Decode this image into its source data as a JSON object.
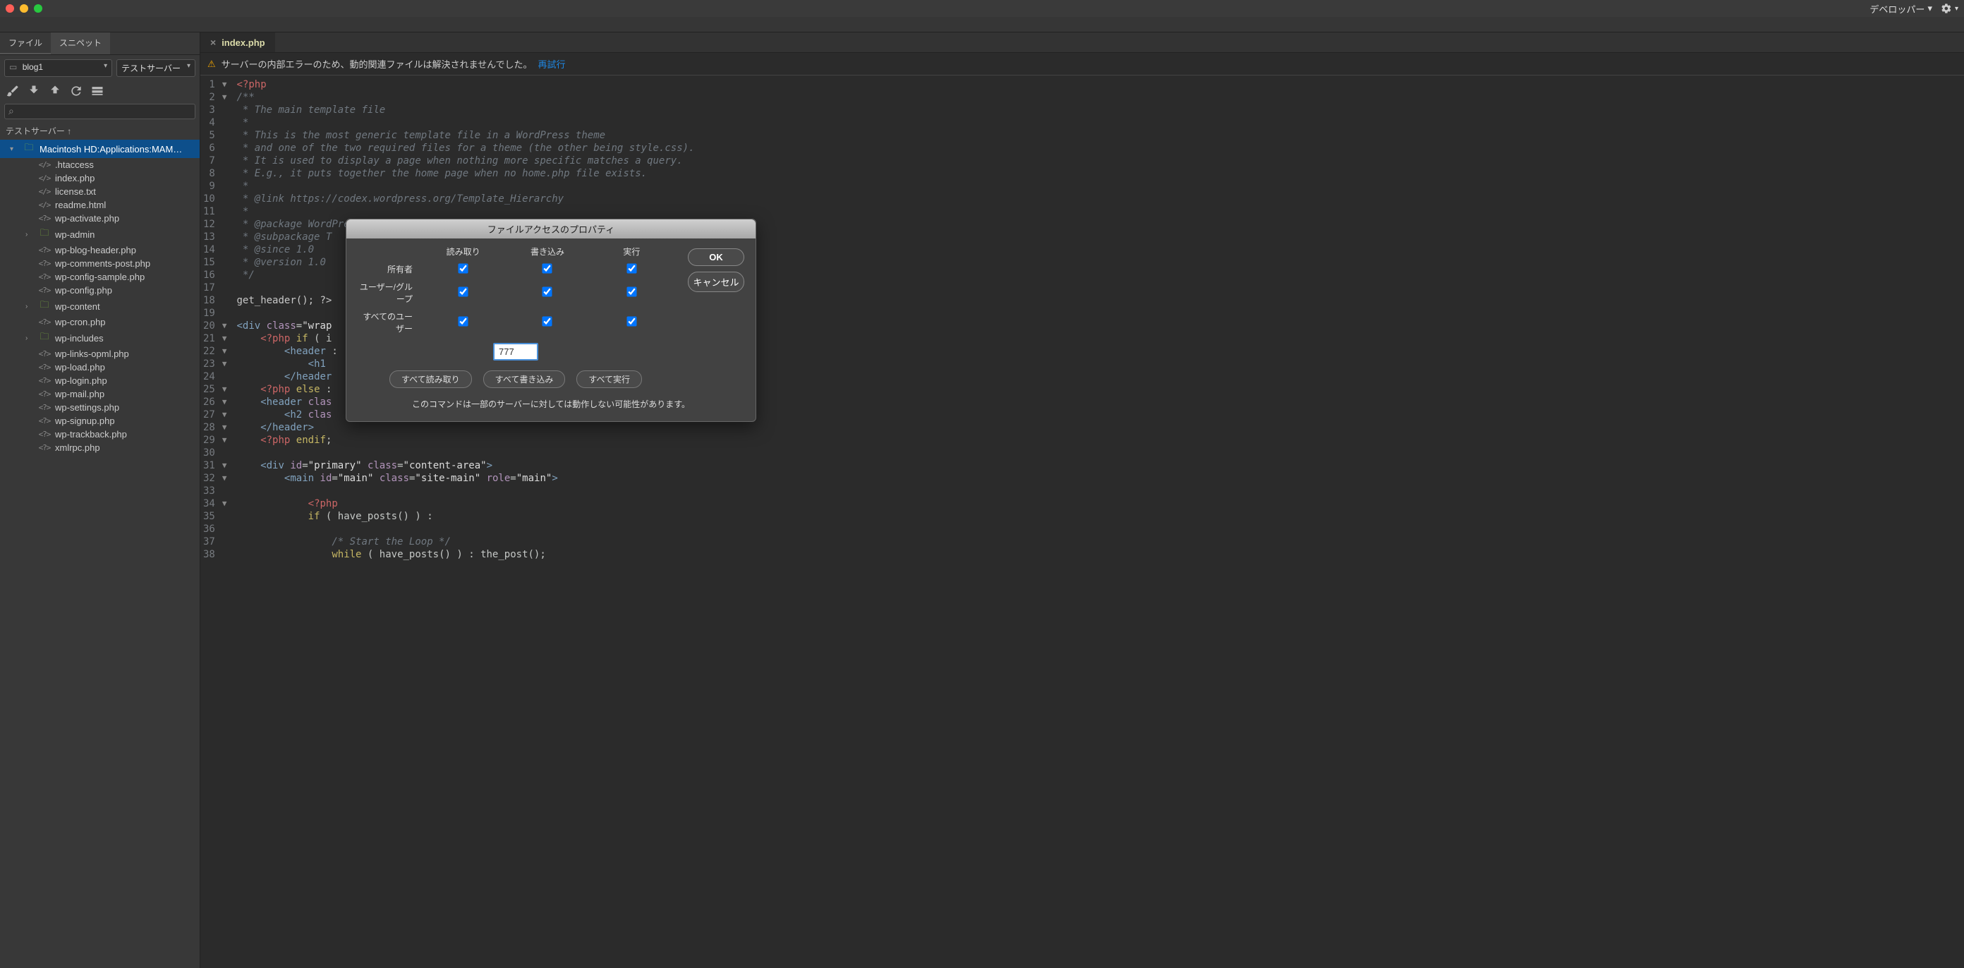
{
  "menubar": {
    "developer": "デベロッパー"
  },
  "sidebar": {
    "tabs": {
      "files": "ファイル",
      "snippets": "スニペット"
    },
    "project_dropdown": "blog1",
    "server_dropdown": "テストサーバー",
    "server_label": "テストサーバー ↑",
    "root": "Macintosh HD:Applications:MAM…",
    "files": [
      {
        "type": "file",
        "icon": "</>",
        "name": ".htaccess"
      },
      {
        "type": "file",
        "icon": "</>",
        "name": "index.php"
      },
      {
        "type": "file",
        "icon": "</>",
        "name": "license.txt"
      },
      {
        "type": "file",
        "icon": "</>",
        "name": "readme.html"
      },
      {
        "type": "file",
        "icon": "<?>",
        "name": "wp-activate.php"
      },
      {
        "type": "folder",
        "expandable": true,
        "name": "wp-admin"
      },
      {
        "type": "file",
        "icon": "<?>",
        "name": "wp-blog-header.php"
      },
      {
        "type": "file",
        "icon": "<?>",
        "name": "wp-comments-post.php"
      },
      {
        "type": "file",
        "icon": "<?>",
        "name": "wp-config-sample.php"
      },
      {
        "type": "file",
        "icon": "<?>",
        "name": "wp-config.php"
      },
      {
        "type": "folder",
        "expandable": true,
        "name": "wp-content"
      },
      {
        "type": "file",
        "icon": "<?>",
        "name": "wp-cron.php"
      },
      {
        "type": "folder",
        "expandable": true,
        "name": "wp-includes"
      },
      {
        "type": "file",
        "icon": "<?>",
        "name": "wp-links-opml.php"
      },
      {
        "type": "file",
        "icon": "<?>",
        "name": "wp-load.php"
      },
      {
        "type": "file",
        "icon": "<?>",
        "name": "wp-login.php"
      },
      {
        "type": "file",
        "icon": "<?>",
        "name": "wp-mail.php"
      },
      {
        "type": "file",
        "icon": "<?>",
        "name": "wp-settings.php"
      },
      {
        "type": "file",
        "icon": "<?>",
        "name": "wp-signup.php"
      },
      {
        "type": "file",
        "icon": "<?>",
        "name": "wp-trackback.php"
      },
      {
        "type": "file",
        "icon": "<?>",
        "name": "xmlrpc.php"
      }
    ]
  },
  "editor": {
    "tab": "index.php",
    "warning": "サーバーの内部エラーのため、動的関連ファイルは解決されませんでした。",
    "retry": "再試行",
    "lines": [
      {
        "n": 1,
        "fold": "▼",
        "raw": "<?php",
        "cls": "tk-tag"
      },
      {
        "n": 2,
        "fold": "▼",
        "raw": "/**",
        "cls": "tk-comment"
      },
      {
        "n": 3,
        "raw": " * The main template file",
        "cls": "tk-comment"
      },
      {
        "n": 4,
        "raw": " *",
        "cls": "tk-comment"
      },
      {
        "n": 5,
        "raw": " * This is the most generic template file in a WordPress theme",
        "cls": "tk-comment"
      },
      {
        "n": 6,
        "raw": " * and one of the two required files for a theme (the other being style.css).",
        "cls": "tk-comment"
      },
      {
        "n": 7,
        "raw": " * It is used to display a page when nothing more specific matches a query.",
        "cls": "tk-comment"
      },
      {
        "n": 8,
        "raw": " * E.g., it puts together the home page when no home.php file exists.",
        "cls": "tk-comment"
      },
      {
        "n": 9,
        "raw": " *",
        "cls": "tk-comment"
      },
      {
        "n": 10,
        "raw": " * @link https://codex.wordpress.org/Template_Hierarchy",
        "cls": "tk-comment"
      },
      {
        "n": 11,
        "raw": " *",
        "cls": "tk-comment"
      },
      {
        "n": 12,
        "raw": " * @package WordPress",
        "cls": "tk-comment"
      },
      {
        "n": 13,
        "raw": " * @subpackage T",
        "cls": "tk-comment"
      },
      {
        "n": 14,
        "raw": " * @since 1.0",
        "cls": "tk-comment"
      },
      {
        "n": 15,
        "raw": " * @version 1.0",
        "cls": "tk-comment"
      },
      {
        "n": 16,
        "raw": " */",
        "cls": "tk-comment"
      },
      {
        "n": 17,
        "raw": "",
        "cls": ""
      },
      {
        "n": 18,
        "raw": "get_header(); ?>",
        "cls": "tk-var"
      },
      {
        "n": 19,
        "raw": "",
        "cls": ""
      },
      {
        "n": 20,
        "fold": "▼",
        "html": "<span class='tk-blue'>&lt;div</span> <span class='tk-attr'>class</span>=<span class='tk-string'>\"wrap</span>"
      },
      {
        "n": 21,
        "fold": "▼",
        "html": "    <span class='tk-tag'>&lt;?php</span> <span class='tk-keyword'>if</span> ( i"
      },
      {
        "n": 22,
        "fold": "▼",
        "html": "        <span class='tk-blue'>&lt;header</span> :"
      },
      {
        "n": 23,
        "fold": "▼",
        "html": "            <span class='tk-blue'>&lt;h1</span>"
      },
      {
        "n": 24,
        "html": "        <span class='tk-blue'>&lt;/header</span>"
      },
      {
        "n": 25,
        "fold": "▼",
        "html": "    <span class='tk-tag'>&lt;?php</span> <span class='tk-keyword'>else</span> :"
      },
      {
        "n": 26,
        "fold": "▼",
        "html": "    <span class='tk-blue'>&lt;header</span> <span class='tk-attr'>clas</span>"
      },
      {
        "n": 27,
        "fold": "▼",
        "html": "        <span class='tk-blue'>&lt;h2</span> <span class='tk-attr'>clas</span>"
      },
      {
        "n": 28,
        "fold": "▼",
        "html": "    <span class='tk-blue'>&lt;/header&gt;</span>"
      },
      {
        "n": 29,
        "fold": "▼",
        "html": "    <span class='tk-tag'>&lt;?php</span> <span class='tk-keyword'>endif</span>;"
      },
      {
        "n": 30,
        "raw": "",
        "cls": ""
      },
      {
        "n": 31,
        "fold": "▼",
        "html": "    <span class='tk-blue'>&lt;div</span> <span class='tk-attr'>id</span>=<span class='tk-string'>\"primary\"</span> <span class='tk-attr'>class</span>=<span class='tk-string'>\"content-area\"</span><span class='tk-blue'>&gt;</span>"
      },
      {
        "n": 32,
        "fold": "▼",
        "html": "        <span class='tk-blue'>&lt;main</span> <span class='tk-attr'>id</span>=<span class='tk-string'>\"main\"</span> <span class='tk-attr'>class</span>=<span class='tk-string'>\"site-main\"</span> <span class='tk-attr'>role</span>=<span class='tk-string'>\"main\"</span><span class='tk-blue'>&gt;</span>"
      },
      {
        "n": 33,
        "raw": "",
        "cls": ""
      },
      {
        "n": 34,
        "fold": "▼",
        "html": "            <span class='tk-tag'>&lt;?php</span>"
      },
      {
        "n": 35,
        "html": "            <span class='tk-keyword'>if</span> ( have_posts() ) :"
      },
      {
        "n": 36,
        "raw": "",
        "cls": ""
      },
      {
        "n": 37,
        "html": "                <span class='tk-comment'>/* Start the Loop */</span>"
      },
      {
        "n": 38,
        "html": "                <span class='tk-keyword'>while</span> ( have_posts() ) : the_post();"
      }
    ]
  },
  "dialog": {
    "title": "ファイルアクセスのプロパティ",
    "cols": {
      "read": "読み取り",
      "write": "書き込み",
      "exec": "実行"
    },
    "rows": {
      "owner": "所有者",
      "group": "ユーザー/グループ",
      "all": "すべてのユーザー"
    },
    "value": "777",
    "buttons": {
      "all_read": "すべて読み取り",
      "all_write": "すべて書き込み",
      "all_exec": "すべて実行"
    },
    "note": "このコマンドは一部のサーバーに対しては動作しない可能性があります。",
    "ok": "OK",
    "cancel": "キャンセル"
  }
}
